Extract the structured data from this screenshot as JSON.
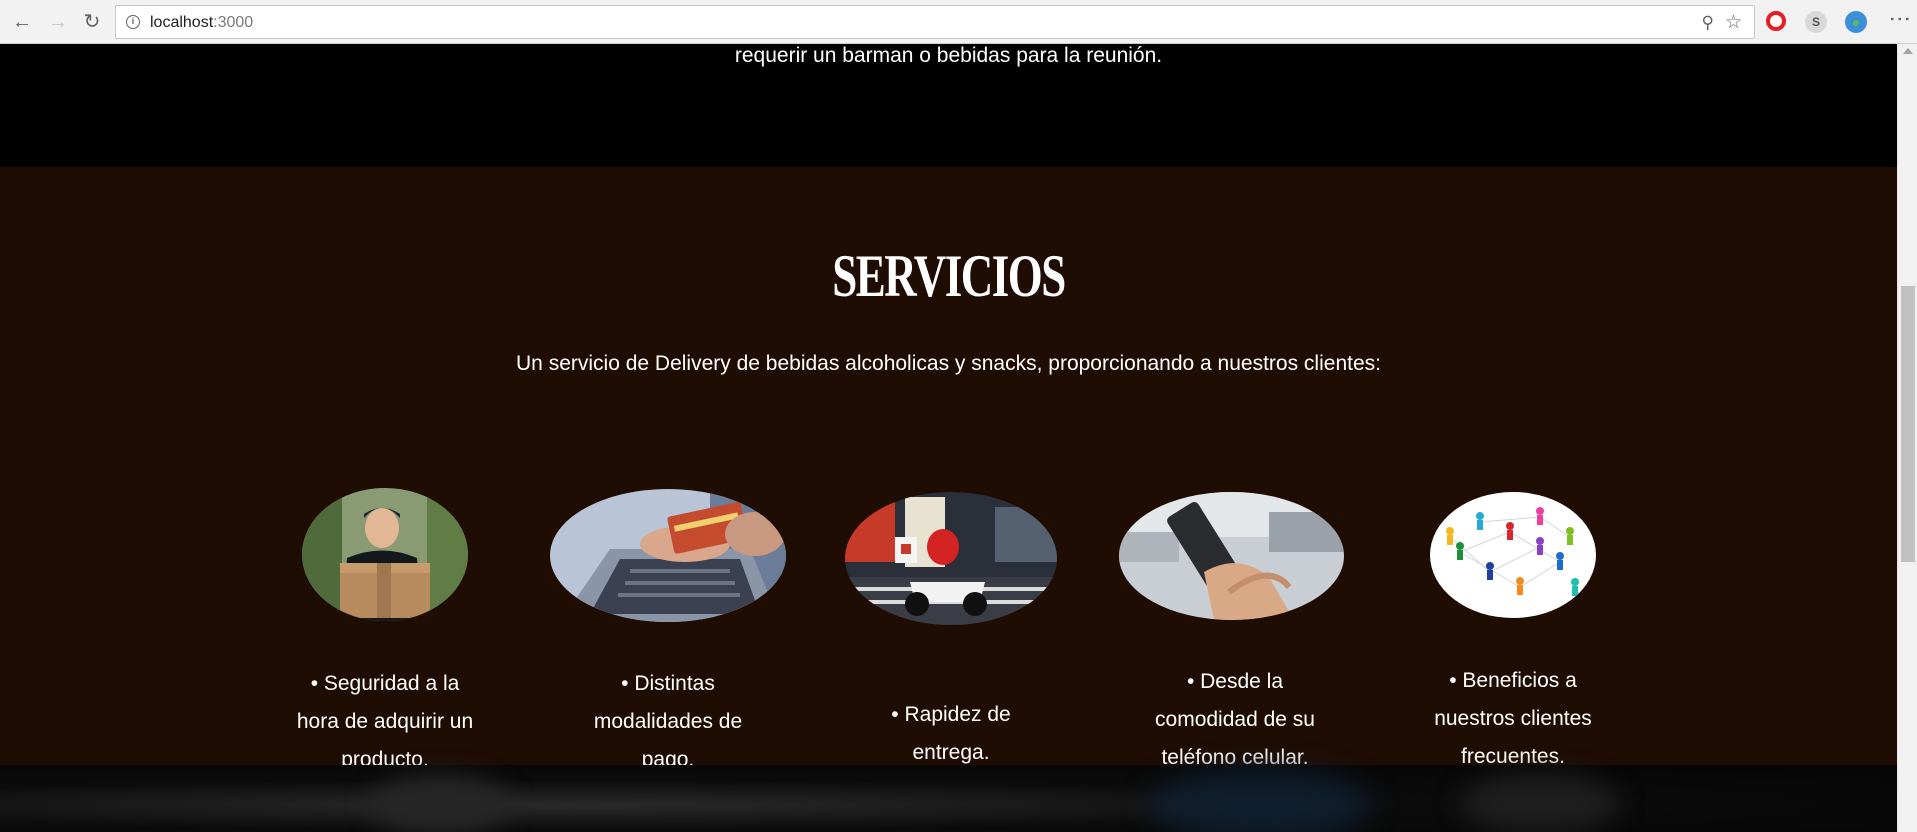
{
  "browser": {
    "url_host": "localhost",
    "url_port": ":3000"
  },
  "top": {
    "tail_text": "requerir un barman o bebidas para la reunión."
  },
  "services": {
    "title": "SERVICIOS",
    "subtitle": "Un servicio de Delivery de bebidas alcoholicas y snacks, proporcionando a nuestros clientes:",
    "items": [
      {
        "caption": "• Seguridad a la hora de adquirir un producto.",
        "image": "delivery-man-with-box"
      },
      {
        "caption": "• Distintas modalidades de pago.",
        "image": "laptop-credit-card"
      },
      {
        "caption": "• Rapidez de entrega.",
        "image": "scooter-delivery"
      },
      {
        "caption": "• Desde la comodidad de su teléfono celular.",
        "image": "hand-holding-phone"
      },
      {
        "caption": "• Beneficios a nuestros clientes frecuentes.",
        "image": "customer-network"
      }
    ]
  }
}
